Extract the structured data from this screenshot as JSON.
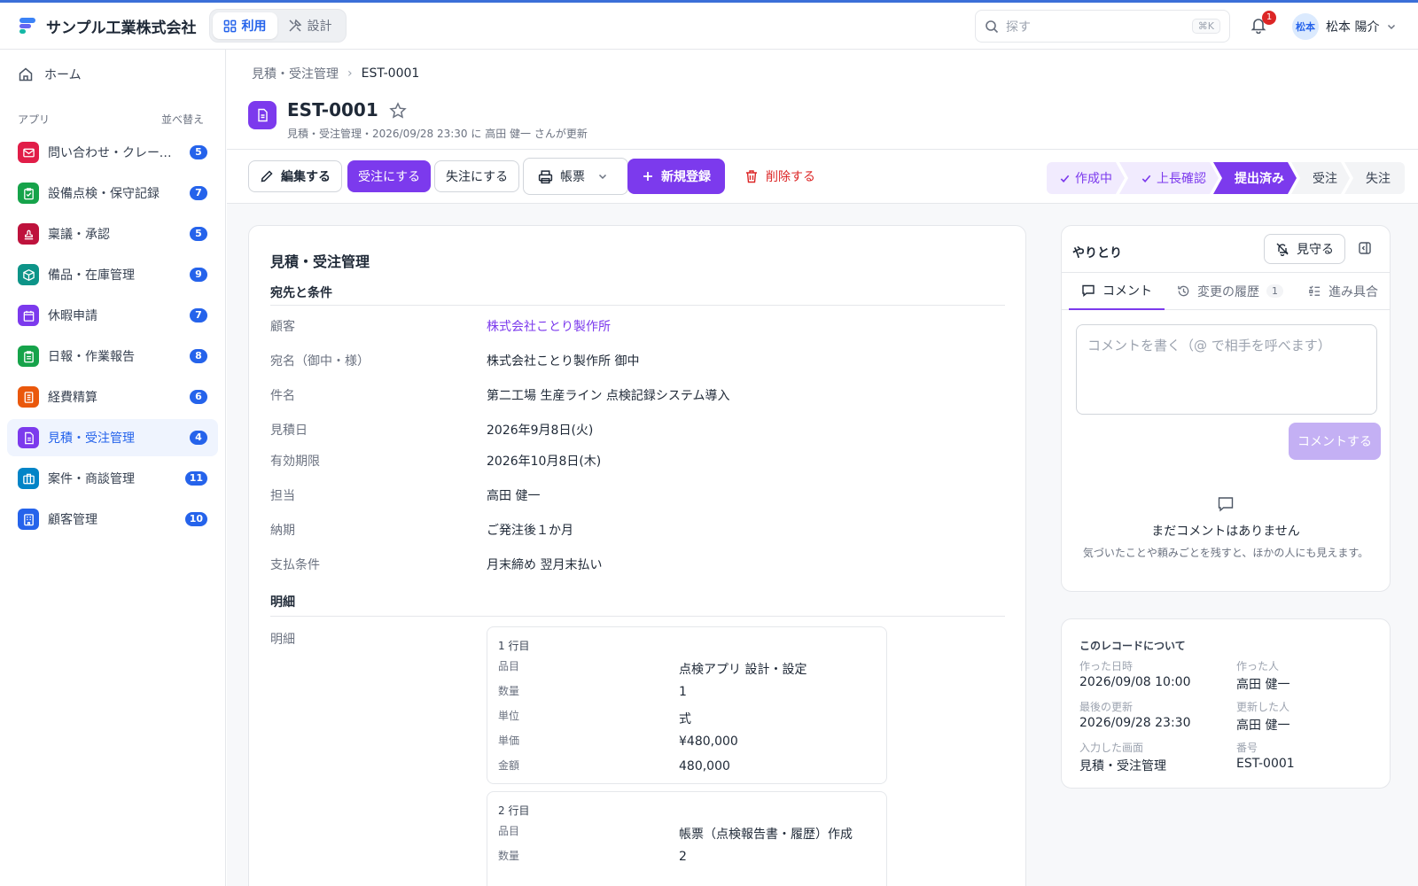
{
  "header": {
    "company": "サンプル工業株式会社",
    "modes": [
      {
        "label": "利用",
        "active": true
      },
      {
        "label": "設計",
        "active": false
      }
    ],
    "search_placeholder": "探す",
    "search_shortcut": "⌘K",
    "notification_count": "1",
    "user_avatar": "松本",
    "user_name": "松本 陽介"
  },
  "sidebar": {
    "home": "ホーム",
    "section_label": "アプリ",
    "sort_label": "並べ替え",
    "items": [
      {
        "label": "問い合わせ・クレーム管理",
        "count": "5",
        "color": "#e11d48",
        "icon": "mail-icon"
      },
      {
        "label": "設備点検・保守記録",
        "count": "7",
        "color": "#16a34a",
        "icon": "clipboard-check-icon"
      },
      {
        "label": "稟議・承認",
        "count": "5",
        "color": "#be123c",
        "icon": "stamp-icon"
      },
      {
        "label": "備品・在庫管理",
        "count": "9",
        "color": "#0d9488",
        "icon": "box-icon"
      },
      {
        "label": "休暇申請",
        "count": "7",
        "color": "#7c3aed",
        "icon": "calendar-icon"
      },
      {
        "label": "日報・作業報告",
        "count": "8",
        "color": "#16a34a",
        "icon": "clipboard-icon"
      },
      {
        "label": "経費精算",
        "count": "6",
        "color": "#ea580c",
        "icon": "receipt-icon"
      },
      {
        "label": "見積・受注管理",
        "count": "4",
        "color": "#7c3aed",
        "icon": "document-icon",
        "active": true
      },
      {
        "label": "案件・商談管理",
        "count": "11",
        "color": "#0284c7",
        "icon": "briefcase-icon"
      },
      {
        "label": "顧客管理",
        "count": "10",
        "color": "#2563eb",
        "icon": "building-icon"
      }
    ]
  },
  "breadcrumb": {
    "parent": "見積・受注管理",
    "current": "EST-0001"
  },
  "record": {
    "title": "EST-0001",
    "subtitle": "見積・受注管理・2026/09/28 23:30 に 高田 健一 さんが更新"
  },
  "toolbar": {
    "edit": "編集する",
    "to_order": "受注にする",
    "to_lost": "失注にする",
    "forms": "帳票",
    "new": "新規登録",
    "delete": "削除する"
  },
  "status_steps": [
    {
      "label": "作成中",
      "state": "done"
    },
    {
      "label": "上長確認",
      "state": "done"
    },
    {
      "label": "提出済み",
      "state": "current"
    },
    {
      "label": "受注",
      "state": "todo"
    },
    {
      "label": "失注",
      "state": "todo"
    }
  ],
  "form": {
    "title": "見積・受注管理",
    "section1": "宛先と条件",
    "fields": [
      {
        "label": "顧客",
        "value": "株式会社ことり製作所"
      },
      {
        "label": "宛名（御中・様）",
        "value": "株式会社ことり製作所 御中"
      },
      {
        "label": "件名",
        "value": "第二工場 生産ライン 点検記録システム導入"
      },
      {
        "label": "見積日",
        "value": "2026年9月8日(火)"
      },
      {
        "label": "有効期限",
        "value": "2026年10月8日(木)"
      },
      {
        "label": "担当",
        "value": "高田 健一"
      },
      {
        "label": "納期",
        "value": "ご発注後１か月"
      },
      {
        "label": "支払条件",
        "value": "月末締め 翌月末払い"
      }
    ],
    "section2": "明細",
    "details_label": "明細",
    "lines": [
      {
        "head": "1 行目",
        "rows": [
          {
            "label": "品目",
            "value": "点検アプリ 設計・設定"
          },
          {
            "label": "数量",
            "value": "1"
          },
          {
            "label": "単位",
            "value": "式"
          },
          {
            "label": "単価",
            "value": "¥480,000"
          },
          {
            "label": "金額",
            "value": "480,000"
          }
        ]
      },
      {
        "head": "2 行目",
        "rows": [
          {
            "label": "品目",
            "value": "帳票（点検報告書・履歴）作成"
          },
          {
            "label": "数量",
            "value": "2"
          }
        ]
      }
    ]
  },
  "panel": {
    "title": "やりとり",
    "watch": "見守る",
    "tabs": [
      {
        "label": "コメント",
        "active": true
      },
      {
        "label": "変更の履歴",
        "count": "1"
      },
      {
        "label": "進み具合"
      }
    ],
    "comment_placeholder": "コメントを書く（@ で相手を呼べます）",
    "comment_button": "コメントする",
    "empty_title": "まだコメントはありません",
    "empty_sub": "気づいたことや頼みごとを残すと、ほかの人にも見えます。"
  },
  "meta": {
    "title": "このレコードについて",
    "created_at_label": "作った日時",
    "created_at": "2026/09/08 10:00",
    "created_by_label": "作った人",
    "created_by": "高田 健一",
    "updated_at_label": "最後の更新",
    "updated_at": "2026/09/28 23:30",
    "updated_by_label": "更新した人",
    "updated_by": "高田 健一",
    "screen_label": "入力した画面",
    "screen": "見積・受注管理",
    "number_label": "番号",
    "number": "EST-0001"
  }
}
